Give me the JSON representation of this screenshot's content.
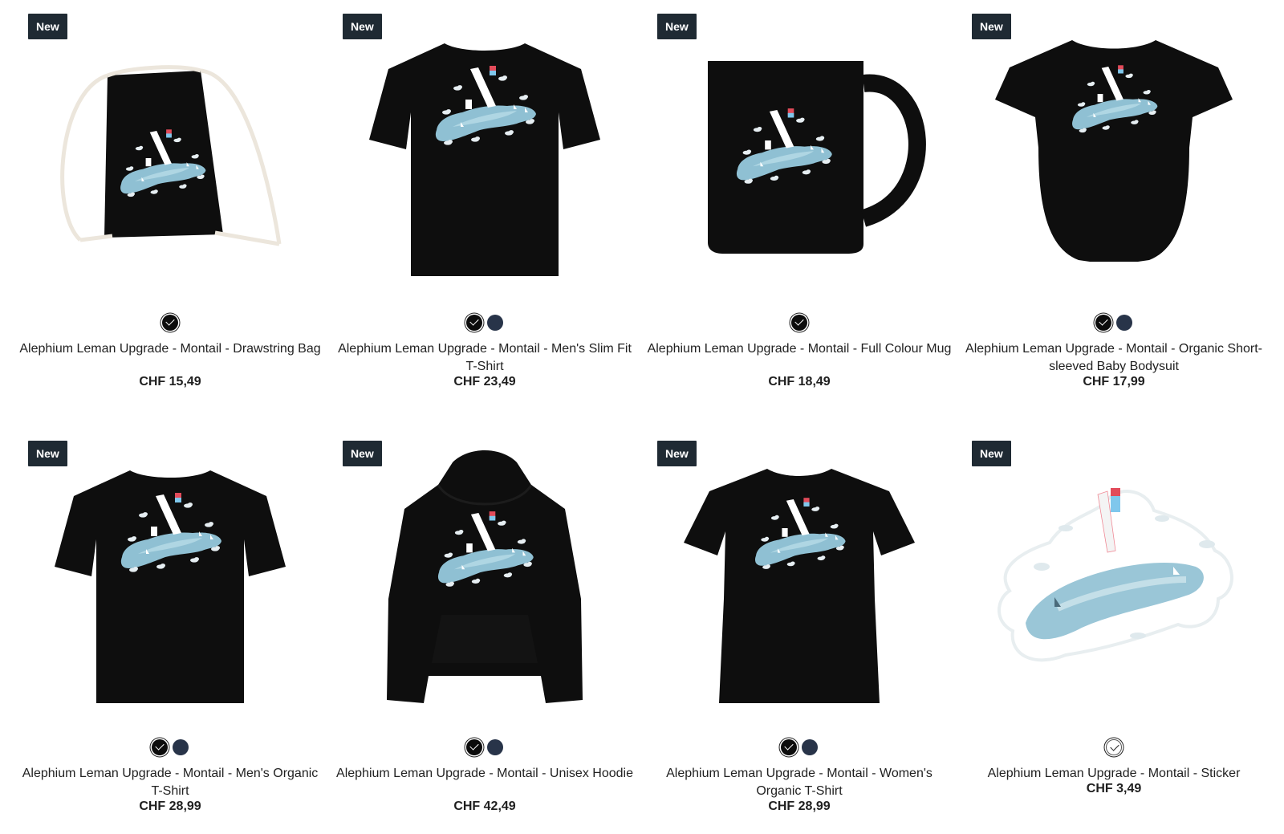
{
  "badge_label": "New",
  "colors": {
    "badge_bg": "#1f2a33",
    "black": "#0c0c0c",
    "navy": "#283449",
    "white": "#ffffff",
    "lake": "#8fbfd2"
  },
  "products": [
    {
      "title": "Alephium Leman Upgrade - Montail - Drawstring Bag",
      "price": "CHF 15,49",
      "product_type": "drawstring-bag",
      "swatches": [
        {
          "color": "black",
          "selected": true
        }
      ]
    },
    {
      "title": "Alephium Leman Upgrade - Montail - Men's Slim Fit T-Shirt",
      "price": "CHF 23,49",
      "product_type": "tshirt",
      "swatches": [
        {
          "color": "black",
          "selected": true
        },
        {
          "color": "navy",
          "selected": false
        }
      ]
    },
    {
      "title": "Alephium Leman Upgrade - Montail - Full Colour Mug",
      "price": "CHF 18,49",
      "product_type": "mug",
      "swatches": [
        {
          "color": "black",
          "selected": true
        }
      ]
    },
    {
      "title": "Alephium Leman Upgrade - Montail - Organic Short-sleeved Baby Bodysuit",
      "price": "CHF 17,99",
      "product_type": "bodysuit",
      "swatches": [
        {
          "color": "black",
          "selected": true
        },
        {
          "color": "navy",
          "selected": false
        }
      ]
    },
    {
      "title": "Alephium Leman Upgrade - Montail - Men's Organic T-Shirt",
      "price": "CHF 28,99",
      "product_type": "tshirt",
      "swatches": [
        {
          "color": "black",
          "selected": true
        },
        {
          "color": "navy",
          "selected": false
        }
      ]
    },
    {
      "title": "Alephium Leman Upgrade - Montail - Unisex Hoodie",
      "price": "CHF 42,49",
      "product_type": "hoodie",
      "swatches": [
        {
          "color": "black",
          "selected": true
        },
        {
          "color": "navy",
          "selected": false
        }
      ]
    },
    {
      "title": "Alephium Leman Upgrade - Montail - Women's Organic T-Shirt",
      "price": "CHF 28,99",
      "product_type": "womens-tshirt",
      "swatches": [
        {
          "color": "black",
          "selected": true
        },
        {
          "color": "navy",
          "selected": false
        }
      ]
    },
    {
      "title": "Alephium Leman Upgrade - Montail - Sticker",
      "price": "CHF 3,49",
      "product_type": "sticker",
      "swatches": [
        {
          "color": "white",
          "selected": true
        }
      ]
    }
  ]
}
